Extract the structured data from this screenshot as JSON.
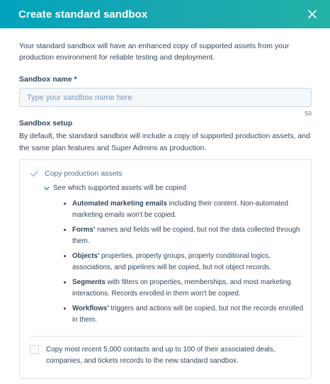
{
  "dialog": {
    "title": "Create standard sandbox",
    "close_icon": "close-icon",
    "intro": "Your standard sandbox will have an enhanced copy of supported assets from your production environment for reliable testing and deployment."
  },
  "form": {
    "name_label": "Sandbox name *",
    "name_placeholder": "Type your sandbox name here",
    "name_value": "",
    "char_limit": "50",
    "setup_label": "Sandbox setup",
    "setup_description": "By default, the standard sandbox will include a copy of supported production assets, and the same plan features and Super Admins as production."
  },
  "options": {
    "copy_assets_label": "Copy production assets",
    "copy_assets_checked": true,
    "toggle_label": "See which supported assets will be copied",
    "assets": [
      {
        "name": "Automated marketing emails",
        "text": " including their content. Non-automated marketing emails won't be copied."
      },
      {
        "name": "Forms'",
        "text": " names and fields will be copied, but not the data collected through them."
      },
      {
        "name": "Objects'",
        "text": " properties, property groups, property conditional logics, associations, and pipelines will be copied, but not object records."
      },
      {
        "name": "Segments",
        "text": " with filters on properties, memberships, and most marketing interactions. Records enrolled in them won't be copied."
      },
      {
        "name": "Workflows'",
        "text": " triggers and actions will be copied, but not the records enrolled in them."
      }
    ],
    "copy_contacts_label": "Copy most recent 5,000 contacts and up to 100 of their associated deals, companies, and tickets records to the new standard sandbox.",
    "copy_contacts_checked": false
  },
  "colors": {
    "header_start": "#00a4bd",
    "header_end": "#23b2a6",
    "check_disabled": "#b0c1d4"
  }
}
